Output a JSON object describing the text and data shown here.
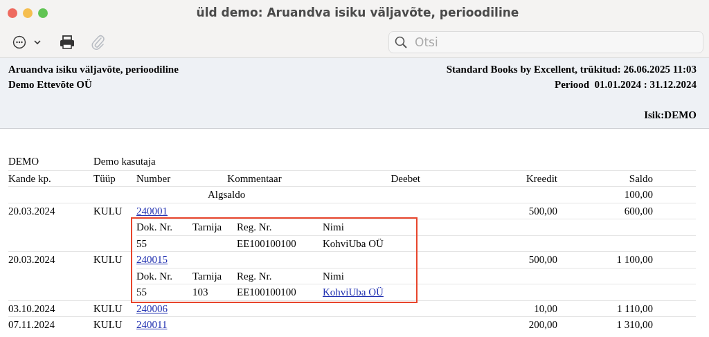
{
  "window": {
    "title": "üld demo: Aruandva isiku väljavõte, perioodiline"
  },
  "toolbar": {
    "buttons": [
      {
        "kind": "more",
        "disabled": false
      },
      {
        "kind": "print",
        "disabled": false
      },
      {
        "kind": "attach",
        "disabled": true
      }
    ],
    "search": {
      "placeholder": "Otsi"
    }
  },
  "report_header": {
    "left": [
      "Aruandva isiku väljavõte, perioodiline",
      "Demo Ettevõte OÜ"
    ],
    "right": [
      "Standard Books by Excellent, trükitud: 26.06.2025 11:03",
      "Periood  01.01.2024 : 31.12.2024"
    ],
    "person": "Isik:DEMO"
  },
  "person": {
    "code": "DEMO",
    "name": "Demo kasutaja"
  },
  "columns": [
    "Kande kp.",
    "Tüüp",
    "Number",
    "Kommentaar",
    "Deebet",
    "Kreedit",
    "Saldo"
  ],
  "opening": {
    "label": "Algsaldo",
    "saldo": "100,00"
  },
  "rows": [
    {
      "date": "20.03.2024",
      "type": "KULU",
      "number": "240001",
      "credit": "500,00",
      "saldo": "600,00",
      "details": {
        "highlighted": true,
        "columns": [
          "Dok. Nr.",
          "Tarnija",
          "Reg. Nr.",
          "Nimi"
        ],
        "doc_no": "55",
        "reg_no": "EE100100100",
        "name": "KohviUba OÜ",
        "name_link": false
      }
    },
    {
      "date": "20.03.2024",
      "type": "KULU",
      "number": "240015",
      "credit": "500,00",
      "saldo": "1 100,00",
      "details": {
        "highlighted": true,
        "columns": [
          "Dok. Nr.",
          "Tarnija",
          "Reg. Nr.",
          "Nimi"
        ],
        "doc_no": "55",
        "supplier": "103",
        "reg_no": "EE100100100",
        "name": "KohviUba OÜ",
        "name_link": true
      }
    },
    {
      "date": "03.10.2024",
      "type": "KULU",
      "number": "240006",
      "credit": "10,00",
      "saldo": "1 110,00"
    },
    {
      "date": "07.11.2024",
      "type": "KULU",
      "number": "240011",
      "credit": "200,00",
      "saldo": "1 310,00"
    }
  ]
}
